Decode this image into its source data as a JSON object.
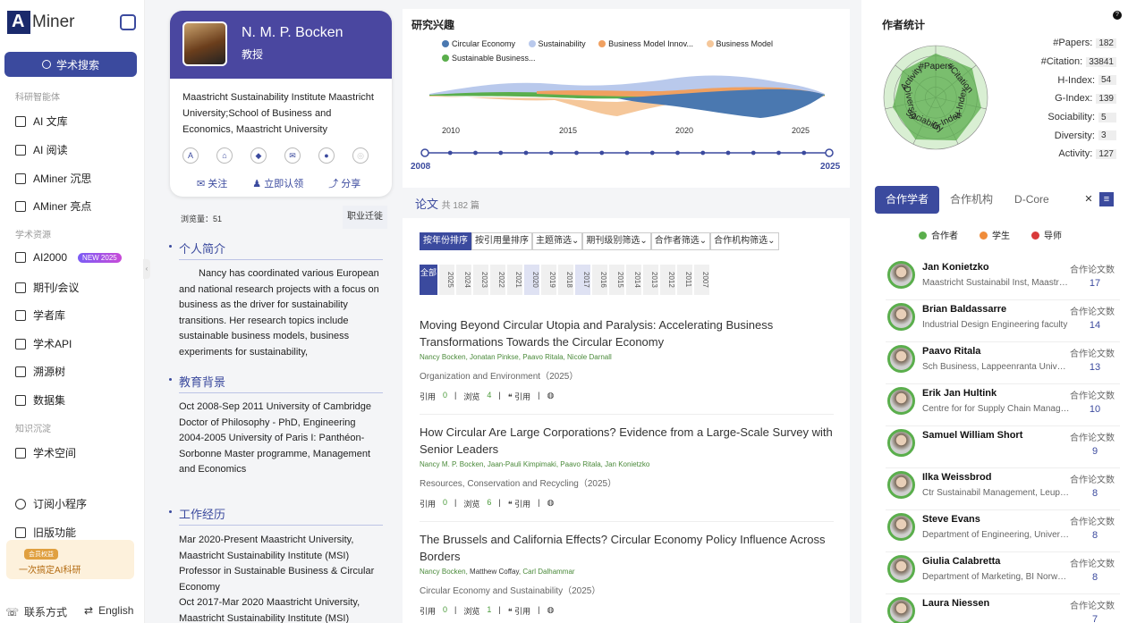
{
  "sidebar": {
    "logo": "Miner",
    "search": "学术搜索",
    "sec1": "科研智能体",
    "items1": [
      "AI 文库",
      "AI 阅读",
      "AMiner 沉思",
      "AMiner 亮点"
    ],
    "sec2": "学术资源",
    "ai2000": "AI2000",
    "new_badge": "NEW 2025",
    "items2": [
      "期刊/会议",
      "学者库",
      "学术API",
      "溯源树",
      "数据集"
    ],
    "sec3": "知识沉淀",
    "items3": [
      "学术空间"
    ],
    "items4": [
      "订阅小程序",
      "旧版功能"
    ],
    "vip_tag": "会员权益",
    "vip_text": "一次搞定AI科研",
    "contact": "联系方式",
    "lang": "English"
  },
  "profile": {
    "name": "N. M. P. Bocken",
    "title": "教授",
    "affiliation": "Maastricht Sustainability Institute Maastricht University;School of Business and Economics, Maastricht University",
    "follow": "关注",
    "claim": "立即认领",
    "share": "分享",
    "views": "浏览量：51",
    "career": "职业迁徙",
    "bio_title": "个人简介",
    "bio": "Nancy has coordinated various European and national research projects with a focus on business as the driver for sustainability transitions. Her research topics include sustainable business models, business experiments for sustainability,",
    "edu_title": "教育背景",
    "edu": [
      "Oct 2008-Sep 2011 University of Cambridge Doctor of Philosophy - PhD, Engineering",
      "2004-2005 University of Paris I: Panthéon-Sorbonne Master programme, Management and Economics"
    ],
    "work_title": "工作经历",
    "work": [
      "Mar 2020-Present Maastricht University, Maastricht Sustainability Institute (MSI) Professor in Sustainable Business & Circular Economy",
      "Oct 2017-Mar 2020 Maastricht University, Maastricht Sustainability Institute (MSI)"
    ]
  },
  "interests": {
    "title": "研究兴趣",
    "legend": [
      {
        "name": "Circular Economy",
        "color": "#4a78b0"
      },
      {
        "name": "Sustainability",
        "color": "#b9c9ec"
      },
      {
        "name": "Business Model Innov...",
        "color": "#f0a060"
      },
      {
        "name": "Business Model",
        "color": "#f5c79a"
      },
      {
        "name": "Sustainable Business...",
        "color": "#5aae4c"
      }
    ],
    "axis": [
      "2010",
      "2015",
      "2020",
      "2025"
    ],
    "range_start": "2008",
    "range_end": "2025"
  },
  "papers": {
    "title": "论文",
    "count_label": "共 182 篇",
    "filters": [
      "按年份排序",
      "按引用量排序",
      "主题筛选",
      "期刊级别筛选",
      "合作者筛选",
      "合作机构筛选"
    ],
    "years_all": "全部",
    "years": [
      "2025",
      "2024",
      "2023",
      "2022",
      "2021",
      "2020",
      "2019",
      "2018",
      "2017",
      "2016",
      "2015",
      "2014",
      "2013",
      "2012",
      "2011",
      "2007"
    ],
    "cite_label": "引用",
    "view_label": "浏览",
    "quote_label": "引用",
    "list": [
      {
        "title": "Moving Beyond Circular Utopia and Paralysis: Accelerating Business Transformations Towards the Circular Economy",
        "authors": [
          "Nancy Bocken",
          "Jonatan Pinkse",
          "Paavo Ritala",
          "Nicole Darnall"
        ],
        "venue": "Organization and Environment（2025）",
        "cites": "0",
        "views": "4"
      },
      {
        "title": "How Circular Are Large Corporations? Evidence from a Large-Scale Survey with Senior Leaders",
        "authors": [
          "Nancy M. P. Bocken",
          "Jaan-Pauli Kimpimaki",
          "Paavo Ritala",
          "Jan Konietzko"
        ],
        "venue": "Resources, Conservation and Recycling（2025）",
        "cites": "0",
        "views": "6"
      },
      {
        "title": "The Brussels and California Effects? Circular Economy Policy Influence Across Borders",
        "authors": [
          "Nancy Bocken",
          "Matthew Coffay",
          "Carl Dalhammar"
        ],
        "venue": "Circular Economy and Sustainability（2025）",
        "cites": "0",
        "views": "1"
      }
    ]
  },
  "stats": {
    "title": "作者统计",
    "help": "?",
    "radar_labels": [
      "#Papers",
      "#Citation",
      "H-Index",
      "G-Index",
      "Sociability",
      "Diversity",
      "Activity"
    ],
    "metrics": [
      {
        "label": "#Papers:",
        "value": "182"
      },
      {
        "label": "#Citation:",
        "value": "33841"
      },
      {
        "label": "H-Index:",
        "value": "54"
      },
      {
        "label": "G-Index:",
        "value": "139"
      },
      {
        "label": "Sociability:",
        "value": "5"
      },
      {
        "label": "Diversity:",
        "value": "3"
      },
      {
        "label": "Activity:",
        "value": "127"
      }
    ],
    "radar_values": [
      0.85,
      0.9,
      0.9,
      0.92,
      0.9,
      0.85,
      0.82
    ]
  },
  "coauthors": {
    "tabs": [
      "合作学者",
      "合作机构",
      "D-Core"
    ],
    "legend": [
      {
        "name": "合作者",
        "color": "#5aae4c"
      },
      {
        "name": "学生",
        "color": "#f08c3a"
      },
      {
        "name": "导师",
        "color": "#d93a3a"
      }
    ],
    "count_label": "合作论文数",
    "list": [
      {
        "name": "Jan Konietzko",
        "org": "Maastricht Sustainabil Inst, Maastricht University",
        "count": "17"
      },
      {
        "name": "Brian Baldassarre",
        "org": "Industrial Design Engineering faculty",
        "count": "14"
      },
      {
        "name": "Paavo Ritala",
        "org": "Sch Business, Lappeenranta University",
        "count": "13"
      },
      {
        "name": "Erik Jan Hultink",
        "org": "Centre for for Supply Chain Management",
        "count": "10"
      },
      {
        "name": "Samuel William Short",
        "org": "",
        "count": "9"
      },
      {
        "name": "Ilka Weissbrod",
        "org": "Ctr Sustainabil Management, Leuphana",
        "count": "8"
      },
      {
        "name": "Steve Evans",
        "org": "Department of Engineering, University of Cambridge",
        "count": "8"
      },
      {
        "name": "Giulia Calabretta",
        "org": "Department of Marketing, BI Norwegian",
        "count": "8"
      },
      {
        "name": "Laura Niessen",
        "org": "",
        "count": "7"
      }
    ]
  }
}
